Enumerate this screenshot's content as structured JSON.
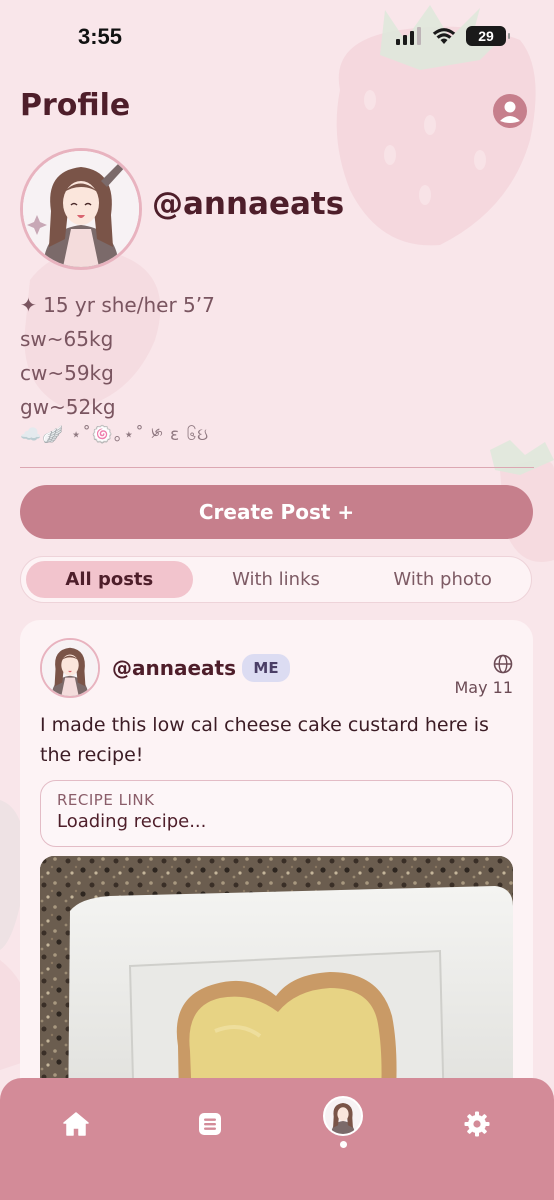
{
  "status_bar": {
    "time": "3:55",
    "battery": "29"
  },
  "header": {
    "title": "Profile"
  },
  "profile": {
    "username": "@annaeats",
    "bio_lines": [
      "✦ 15 yr she/her 5’7",
      "sw~65kg",
      "cw~59kg",
      "gw~52kg"
    ],
    "bio_emoji": "☁️🪽 ⋆˚🍥｡⋆˚ ༯ ε ၆ઇ"
  },
  "actions": {
    "create_post": "Create Post +"
  },
  "tabs": [
    {
      "label": "All posts",
      "active": true
    },
    {
      "label": "With links",
      "active": false
    },
    {
      "label": "With photo",
      "active": false
    }
  ],
  "post": {
    "username": "@annaeats",
    "badge": "ME",
    "date": "May 11",
    "text": "I made this low cal cheese cake custard here is the recipe!",
    "recipe_label": "RECIPE LINK",
    "recipe_status": "Loading recipe..."
  },
  "nav": {
    "items": [
      "home-icon",
      "list-icon",
      "profile-avatar",
      "settings-icon"
    ],
    "active": "profile-avatar"
  },
  "colors": {
    "accent": "#c67f8c",
    "nav": "#d38b98",
    "background": "#f9e6ea",
    "title": "#4e1e2a"
  }
}
